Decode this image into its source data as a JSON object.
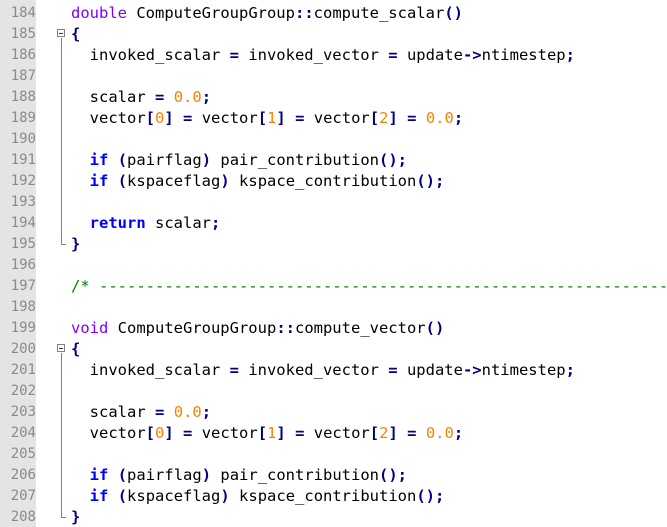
{
  "editor": {
    "colors": {
      "gutter_bg": "#e4e4e4",
      "line_number": "#8a8a8a",
      "keyword_type": "#8000ff",
      "keyword": "#0000ff",
      "number": "#ff8000",
      "operator": "#000080",
      "comment": "#008000"
    },
    "lines": [
      {
        "num": "184",
        "fold": "none",
        "tokens": [
          [
            "kwt",
            "double"
          ],
          [
            "t",
            " ComputeGroupGroup"
          ],
          [
            "op",
            "::"
          ],
          [
            "t",
            "compute_scalar"
          ],
          [
            "op",
            "()"
          ]
        ]
      },
      {
        "num": "185",
        "fold": "open",
        "tokens": [
          [
            "op",
            "{"
          ]
        ]
      },
      {
        "num": "186",
        "fold": "bar",
        "tokens": [
          [
            "t",
            "  invoked_scalar "
          ],
          [
            "op",
            "="
          ],
          [
            "t",
            " invoked_vector "
          ],
          [
            "op",
            "="
          ],
          [
            "t",
            " update"
          ],
          [
            "op",
            "->"
          ],
          [
            "t",
            "ntimestep"
          ],
          [
            "op",
            ";"
          ]
        ]
      },
      {
        "num": "187",
        "fold": "bar",
        "tokens": []
      },
      {
        "num": "188",
        "fold": "bar",
        "tokens": [
          [
            "t",
            "  scalar "
          ],
          [
            "op",
            "="
          ],
          [
            "t",
            " "
          ],
          [
            "num",
            "0.0"
          ],
          [
            "op",
            ";"
          ]
        ]
      },
      {
        "num": "189",
        "fold": "bar",
        "tokens": [
          [
            "t",
            "  vector"
          ],
          [
            "op",
            "["
          ],
          [
            "num",
            "0"
          ],
          [
            "op",
            "]"
          ],
          [
            "t",
            " "
          ],
          [
            "op",
            "="
          ],
          [
            "t",
            " vector"
          ],
          [
            "op",
            "["
          ],
          [
            "num",
            "1"
          ],
          [
            "op",
            "]"
          ],
          [
            "t",
            " "
          ],
          [
            "op",
            "="
          ],
          [
            "t",
            " vector"
          ],
          [
            "op",
            "["
          ],
          [
            "num",
            "2"
          ],
          [
            "op",
            "]"
          ],
          [
            "t",
            " "
          ],
          [
            "op",
            "="
          ],
          [
            "t",
            " "
          ],
          [
            "num",
            "0.0"
          ],
          [
            "op",
            ";"
          ]
        ]
      },
      {
        "num": "190",
        "fold": "bar",
        "tokens": []
      },
      {
        "num": "191",
        "fold": "bar",
        "tokens": [
          [
            "t",
            "  "
          ],
          [
            "kw",
            "if"
          ],
          [
            "t",
            " "
          ],
          [
            "op",
            "("
          ],
          [
            "t",
            "pairflag"
          ],
          [
            "op",
            ")"
          ],
          [
            "t",
            " pair_contribution"
          ],
          [
            "op",
            "();"
          ]
        ]
      },
      {
        "num": "192",
        "fold": "bar",
        "tokens": [
          [
            "t",
            "  "
          ],
          [
            "kw",
            "if"
          ],
          [
            "t",
            " "
          ],
          [
            "op",
            "("
          ],
          [
            "t",
            "kspaceflag"
          ],
          [
            "op",
            ")"
          ],
          [
            "t",
            " kspace_contribution"
          ],
          [
            "op",
            "();"
          ]
        ]
      },
      {
        "num": "193",
        "fold": "bar",
        "tokens": []
      },
      {
        "num": "194",
        "fold": "bar",
        "tokens": [
          [
            "t",
            "  "
          ],
          [
            "kw",
            "return"
          ],
          [
            "t",
            " scalar"
          ],
          [
            "op",
            ";"
          ]
        ]
      },
      {
        "num": "195",
        "fold": "end",
        "tokens": [
          [
            "op",
            "}"
          ]
        ]
      },
      {
        "num": "196",
        "fold": "none",
        "tokens": []
      },
      {
        "num": "197",
        "fold": "none",
        "tokens": [
          [
            "cmt",
            "/* ----------------------------------------------------------------------"
          ]
        ]
      },
      {
        "num": "198",
        "fold": "none",
        "tokens": []
      },
      {
        "num": "199",
        "fold": "none",
        "tokens": [
          [
            "kwt",
            "void"
          ],
          [
            "t",
            " ComputeGroupGroup"
          ],
          [
            "op",
            "::"
          ],
          [
            "t",
            "compute_vector"
          ],
          [
            "op",
            "()"
          ]
        ]
      },
      {
        "num": "200",
        "fold": "open",
        "tokens": [
          [
            "op",
            "{"
          ]
        ]
      },
      {
        "num": "201",
        "fold": "bar",
        "tokens": [
          [
            "t",
            "  invoked_scalar "
          ],
          [
            "op",
            "="
          ],
          [
            "t",
            " invoked_vector "
          ],
          [
            "op",
            "="
          ],
          [
            "t",
            " update"
          ],
          [
            "op",
            "->"
          ],
          [
            "t",
            "ntimestep"
          ],
          [
            "op",
            ";"
          ]
        ]
      },
      {
        "num": "202",
        "fold": "bar",
        "tokens": []
      },
      {
        "num": "203",
        "fold": "bar",
        "tokens": [
          [
            "t",
            "  scalar "
          ],
          [
            "op",
            "="
          ],
          [
            "t",
            " "
          ],
          [
            "num",
            "0.0"
          ],
          [
            "op",
            ";"
          ]
        ]
      },
      {
        "num": "204",
        "fold": "bar",
        "tokens": [
          [
            "t",
            "  vector"
          ],
          [
            "op",
            "["
          ],
          [
            "num",
            "0"
          ],
          [
            "op",
            "]"
          ],
          [
            "t",
            " "
          ],
          [
            "op",
            "="
          ],
          [
            "t",
            " vector"
          ],
          [
            "op",
            "["
          ],
          [
            "num",
            "1"
          ],
          [
            "op",
            "]"
          ],
          [
            "t",
            " "
          ],
          [
            "op",
            "="
          ],
          [
            "t",
            " vector"
          ],
          [
            "op",
            "["
          ],
          [
            "num",
            "2"
          ],
          [
            "op",
            "]"
          ],
          [
            "t",
            " "
          ],
          [
            "op",
            "="
          ],
          [
            "t",
            " "
          ],
          [
            "num",
            "0.0"
          ],
          [
            "op",
            ";"
          ]
        ]
      },
      {
        "num": "205",
        "fold": "bar",
        "tokens": []
      },
      {
        "num": "206",
        "fold": "bar",
        "tokens": [
          [
            "t",
            "  "
          ],
          [
            "kw",
            "if"
          ],
          [
            "t",
            " "
          ],
          [
            "op",
            "("
          ],
          [
            "t",
            "pairflag"
          ],
          [
            "op",
            ")"
          ],
          [
            "t",
            " pair_contribution"
          ],
          [
            "op",
            "();"
          ]
        ]
      },
      {
        "num": "207",
        "fold": "bar",
        "tokens": [
          [
            "t",
            "  "
          ],
          [
            "kw",
            "if"
          ],
          [
            "t",
            " "
          ],
          [
            "op",
            "("
          ],
          [
            "t",
            "kspaceflag"
          ],
          [
            "op",
            ")"
          ],
          [
            "t",
            " kspace_contribution"
          ],
          [
            "op",
            "();"
          ]
        ]
      },
      {
        "num": "208",
        "fold": "end",
        "tokens": [
          [
            "op",
            "}"
          ]
        ]
      }
    ]
  }
}
